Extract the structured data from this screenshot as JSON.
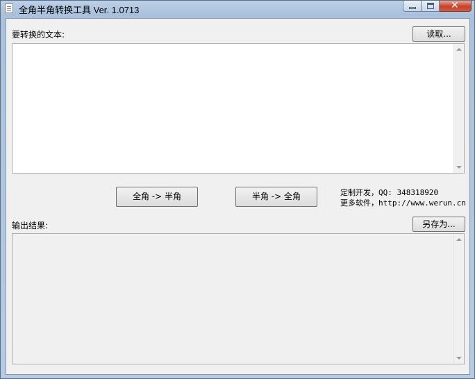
{
  "window": {
    "title": "全角半角转换工具 Ver. 1.0713",
    "close_glyph": "✕"
  },
  "input_section": {
    "label": "要转换的文本:",
    "read_button": "读取...",
    "text": ""
  },
  "actions": {
    "to_halfwidth": "全角 -> 半角",
    "to_fullwidth": "半角 -> 全角"
  },
  "info": {
    "line1": "定制开发，QQ: 348318920",
    "line2": "更多软件，http://www.werun.cn"
  },
  "output_section": {
    "label": "输出结果:",
    "save_button": "另存为...",
    "text": ""
  }
}
